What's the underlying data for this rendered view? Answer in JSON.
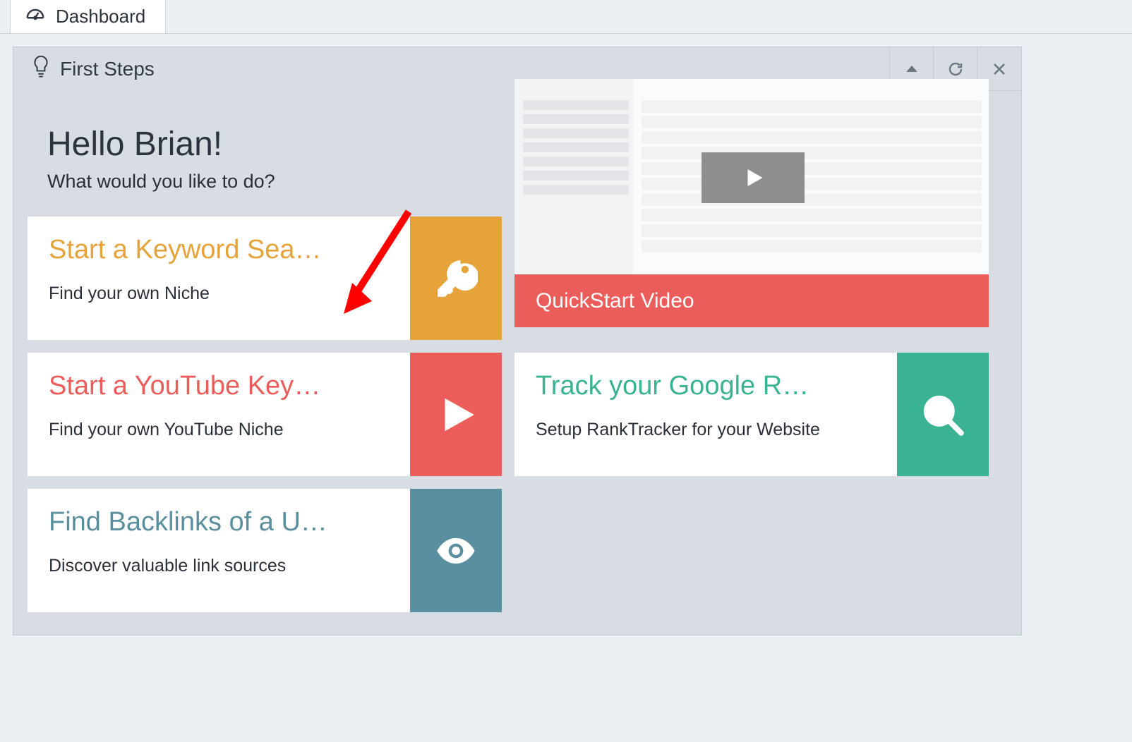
{
  "tab": {
    "label": "Dashboard"
  },
  "panel": {
    "title": "First Steps"
  },
  "greeting": {
    "headline": "Hello Brian!",
    "subline": "What would you like to do?"
  },
  "video": {
    "caption": "QuickStart Video"
  },
  "cards": {
    "keyword": {
      "title": "Start a Keyword Sea",
      "sub": "Find your own Niche"
    },
    "youtube": {
      "title": "Start a YouTube Key",
      "sub": "Find your own YouTube Niche"
    },
    "backlinks": {
      "title": "Find Backlinks of a U",
      "sub": "Discover valuable link sources"
    },
    "rank": {
      "title": "Track your Google R",
      "sub": "Setup RankTracker for your Website"
    }
  },
  "colors": {
    "orange": "#e6a33a",
    "red": "#ea5d5a",
    "teal": "#3ab392",
    "slate": "#5a8fa0"
  }
}
